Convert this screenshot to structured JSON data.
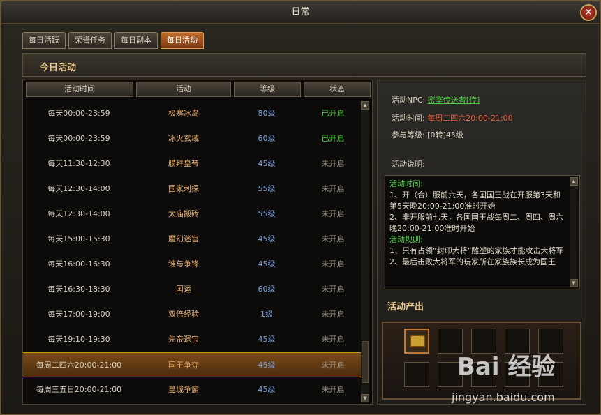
{
  "window": {
    "title": "日常"
  },
  "tabs": [
    {
      "label": "每日活跃",
      "active": false
    },
    {
      "label": "荣誉任务",
      "active": false
    },
    {
      "label": "每日副本",
      "active": false
    },
    {
      "label": "每日活动",
      "active": true
    }
  ],
  "section": {
    "title": "今日活动"
  },
  "table": {
    "headers": [
      "活动时间",
      "活动",
      "等级",
      "状态"
    ],
    "rows": [
      {
        "time": "每天00:00-23:59",
        "activity": "极寒冰岛",
        "level": "80级",
        "status": "已开启",
        "open": true
      },
      {
        "time": "每天00:00-23:59",
        "activity": "冰火玄域",
        "level": "60级",
        "status": "已开启",
        "open": true
      },
      {
        "time": "每天11:30-12:30",
        "activity": "膜拜皇帝",
        "level": "45级",
        "status": "未开启",
        "open": false
      },
      {
        "time": "每天12:30-14:00",
        "activity": "国家刺探",
        "level": "55级",
        "status": "未开启",
        "open": false
      },
      {
        "time": "每天12:30-14:00",
        "activity": "太庙搬砖",
        "level": "55级",
        "status": "未开启",
        "open": false
      },
      {
        "time": "每天15:00-15:30",
        "activity": "魔幻迷宫",
        "level": "45级",
        "status": "未开启",
        "open": false
      },
      {
        "time": "每天16:00-16:30",
        "activity": "谁与争锋",
        "level": "45级",
        "status": "未开启",
        "open": false
      },
      {
        "time": "每天16:30-18:30",
        "activity": "国运",
        "level": "60级",
        "status": "未开启",
        "open": false
      },
      {
        "time": "每天17:00-19:00",
        "activity": "双倍经验",
        "level": "1级",
        "status": "未开启",
        "open": false
      },
      {
        "time": "每天19:10-19:30",
        "activity": "先帝遗宝",
        "level": "45级",
        "status": "未开启",
        "open": false
      },
      {
        "time": "每周二四六20:00-21:00",
        "activity": "国王争夺",
        "level": "45级",
        "status": "未开启",
        "open": false,
        "selected": true
      },
      {
        "time": "每周三五日20:00-21:00",
        "activity": "皇城争霸",
        "level": "45级",
        "status": "未开启",
        "open": false
      }
    ]
  },
  "detail": {
    "npc_label": "活动NPC:",
    "npc_value": "密室传送者[传]",
    "time_label": "活动时间:",
    "time_value": "每周二四六20:00-21:00",
    "level_label": "参与等级:",
    "level_value": "[0转]45级",
    "desc_label": "活动说明:",
    "desc": [
      {
        "text": "活动时间:",
        "green": true
      },
      {
        "text": "1、开（合）服前六天，各国国王战在开服第3天和第5天晚20:00-21:00准时开始",
        "green": false
      },
      {
        "text": "2、非开服前七天，各国国王战每周二、周四、周六晚20:00-21:00准时开始",
        "green": false
      },
      {
        "text": "活动规则:",
        "green": true
      },
      {
        "text": "1、只有占领“封印大将”雕塑的家族才能攻击大将军",
        "green": false
      },
      {
        "text": "2、最后击败大将军的玩家所在家族族长成为国王",
        "green": false
      }
    ],
    "output_title": "活动产出"
  },
  "watermark": {
    "logo": "Bai 经验",
    "url": "jingyan.baidu.com"
  }
}
